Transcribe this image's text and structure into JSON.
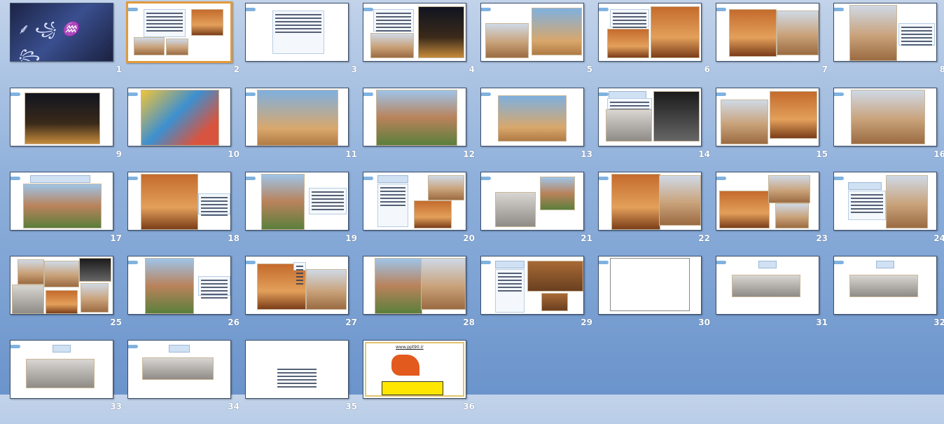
{
  "view": "slide-sorter",
  "selected_slide": 2,
  "slides": [
    {
      "number": "1",
      "kind": "calligraphy"
    },
    {
      "number": "2",
      "kind": "image-text"
    },
    {
      "number": "3",
      "kind": "text"
    },
    {
      "number": "4",
      "kind": "image-text"
    },
    {
      "number": "5",
      "kind": "images"
    },
    {
      "number": "6",
      "kind": "image-text"
    },
    {
      "number": "7",
      "kind": "images"
    },
    {
      "number": "8",
      "kind": "image-text"
    },
    {
      "number": "9",
      "kind": "image"
    },
    {
      "number": "10",
      "kind": "image"
    },
    {
      "number": "11",
      "kind": "image"
    },
    {
      "number": "12",
      "kind": "image"
    },
    {
      "number": "13",
      "kind": "image"
    },
    {
      "number": "14",
      "kind": "image-text"
    },
    {
      "number": "15",
      "kind": "images"
    },
    {
      "number": "16",
      "kind": "image"
    },
    {
      "number": "17",
      "kind": "image-text"
    },
    {
      "number": "18",
      "kind": "image-text"
    },
    {
      "number": "19",
      "kind": "image-text"
    },
    {
      "number": "20",
      "kind": "image-text"
    },
    {
      "number": "21",
      "kind": "images"
    },
    {
      "number": "22",
      "kind": "images"
    },
    {
      "number": "23",
      "kind": "images"
    },
    {
      "number": "24",
      "kind": "image-text"
    },
    {
      "number": "25",
      "kind": "images"
    },
    {
      "number": "26",
      "kind": "image-text"
    },
    {
      "number": "27",
      "kind": "images"
    },
    {
      "number": "28",
      "kind": "images"
    },
    {
      "number": "29",
      "kind": "image-text"
    },
    {
      "number": "30",
      "kind": "diagram"
    },
    {
      "number": "31",
      "kind": "images"
    },
    {
      "number": "32",
      "kind": "images"
    },
    {
      "number": "33",
      "kind": "images"
    },
    {
      "number": "34",
      "kind": "images"
    },
    {
      "number": "35",
      "kind": "text"
    },
    {
      "number": "36",
      "kind": "promo"
    }
  ],
  "promo": {
    "website": "www.ppt90.ir"
  }
}
